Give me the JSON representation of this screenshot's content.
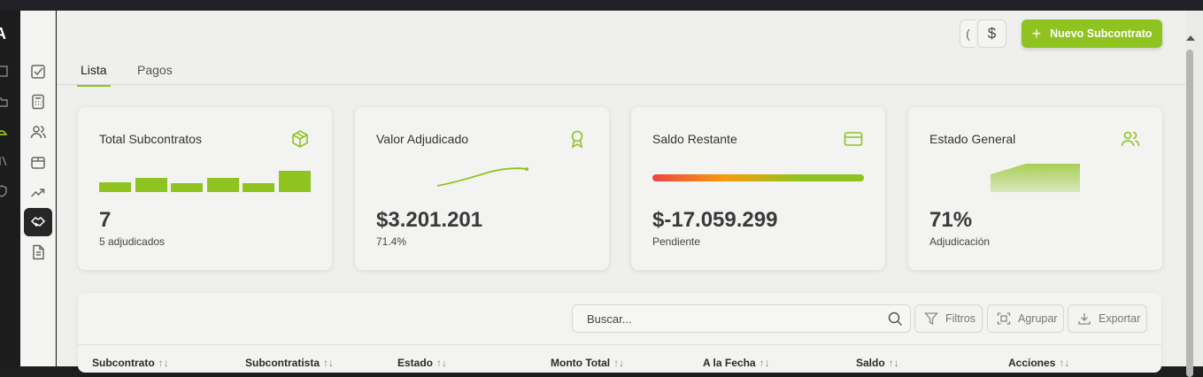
{
  "app": {
    "logo_text": "A",
    "accent_color": "#8fc31f"
  },
  "sidebar": {
    "items": [
      {
        "icon": "checkbox-icon"
      },
      {
        "icon": "calculator-icon"
      },
      {
        "icon": "users-icon"
      },
      {
        "icon": "package-icon"
      },
      {
        "icon": "trending-up-icon"
      },
      {
        "icon": "handshake-icon",
        "active": true
      },
      {
        "icon": "document-icon"
      }
    ]
  },
  "header": {
    "toggle_label": "(",
    "currency_label": "$",
    "new_button_label": "Nuevo Subcontrato",
    "new_button_icon": "plus-icon"
  },
  "tabs": [
    {
      "label": "Lista",
      "active": true
    },
    {
      "label": "Pagos",
      "active": false
    }
  ],
  "cards": [
    {
      "title": "Total Subcontratos",
      "icon": "cube-icon",
      "value": "7",
      "sub": "5 adjudicados",
      "bar_levels": [
        0.42,
        0.62,
        0.38,
        0.62,
        0.38,
        0.96
      ]
    },
    {
      "title": "Valor Adjudicado",
      "icon": "award-icon",
      "value": "$3.201.201",
      "sub": "71.4%"
    },
    {
      "title": "Saldo Restante",
      "icon": "credit-card-icon",
      "value": "$-17.059.299",
      "sub": "Pendiente",
      "gradient_colors": [
        "#ef4444",
        "#f59e0b",
        "#8fc31f"
      ]
    },
    {
      "title": "Estado General",
      "icon": "users-icon",
      "value": "71%",
      "sub": "Adjudicación"
    }
  ],
  "table": {
    "search_placeholder": "Buscar...",
    "filter_label": "Filtros",
    "group_label": "Agrupar",
    "export_label": "Exportar",
    "sort_glyph": "↑↓",
    "columns": [
      "Subcontrato",
      "Subcontratista",
      "Estado",
      "Monto Total",
      "A la Fecha",
      "Saldo",
      "Acciones"
    ]
  }
}
